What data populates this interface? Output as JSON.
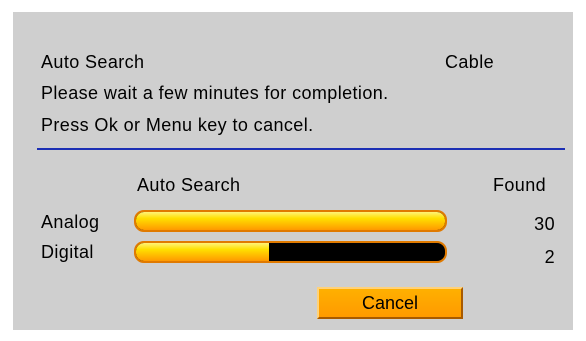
{
  "header": {
    "title": "Auto Search",
    "mode": "Cable",
    "line1": "Please wait a few minutes for completion.",
    "line2": "Press Ok or Menu key to cancel."
  },
  "table": {
    "col_search": "Auto Search",
    "col_found": "Found",
    "rows": [
      {
        "label": "Analog",
        "found": "30",
        "progress": 1.0
      },
      {
        "label": "Digital",
        "found": "2",
        "progress": 0.43
      }
    ]
  },
  "actions": {
    "cancel_label": "Cancel"
  },
  "colors": {
    "panel_bg": "#cfcfcf",
    "divider": "#1c2fb4",
    "bar_fill": "#ffc400",
    "bar_track": "#000000",
    "bar_border": "#e07a00",
    "button_bg": "#ffa000"
  }
}
